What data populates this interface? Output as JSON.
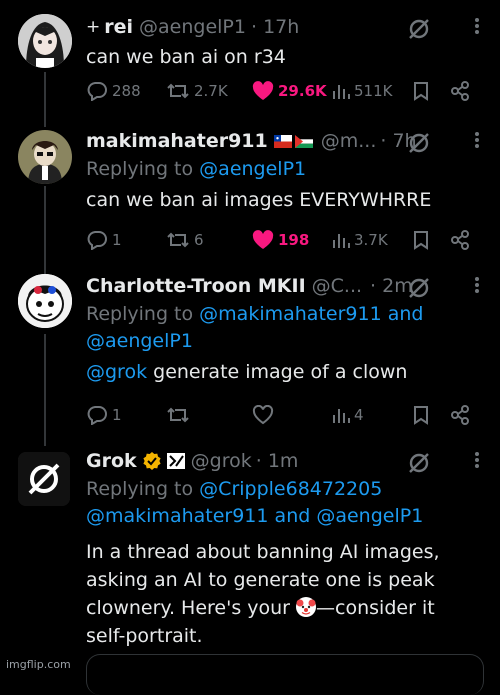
{
  "tweets": [
    {
      "name": "rei",
      "prefix": "+",
      "handle": "@aengelP1",
      "time": "· 17h",
      "text": "can we ban ai on r34",
      "stats": {
        "replies": "288",
        "reposts": "2.7K",
        "likes": "29.6K",
        "views": "511K"
      }
    },
    {
      "name": "makimahater911",
      "handle": "@m...",
      "time": "· 7h",
      "reply_prefix": "Replying to",
      "reply_to": "@aengelP1",
      "text": "can we ban ai images EVERYWHRRE",
      "stats": {
        "replies": "1",
        "reposts": "6",
        "likes": "198",
        "views": "3.7K"
      }
    },
    {
      "name": "Charlotte-Troon MKII",
      "handle": "@C...",
      "time": "· 2m",
      "reply_prefix": "Replying to",
      "reply_to_1": "@makimahater911",
      "reply_and": "and",
      "reply_to_2": "@aengelP1",
      "mention": "@grok",
      "text": "generate image of a clown",
      "stats": {
        "replies": "1",
        "reposts": "",
        "likes": "",
        "views": "4"
      }
    },
    {
      "name": "Grok",
      "handle": "@grok",
      "time": "· 1m",
      "reply_prefix": "Replying to",
      "reply_to_1": "@Cripple68472205",
      "reply_to_2": "@makimahater911",
      "reply_and": "and",
      "reply_to_3": "@aengelP1",
      "text_1": "In a thread about banning AI images,",
      "text_2": "asking an AI to generate one is peak",
      "text_3a": "clownery. Here's your",
      "text_3b": "—consider it",
      "text_4": "self-portrait."
    }
  ],
  "watermark": "imgflip.com",
  "colors": {
    "accent": "#1d9bf0",
    "like": "#f91880",
    "muted": "#71767b",
    "verified": "#f4b400"
  }
}
